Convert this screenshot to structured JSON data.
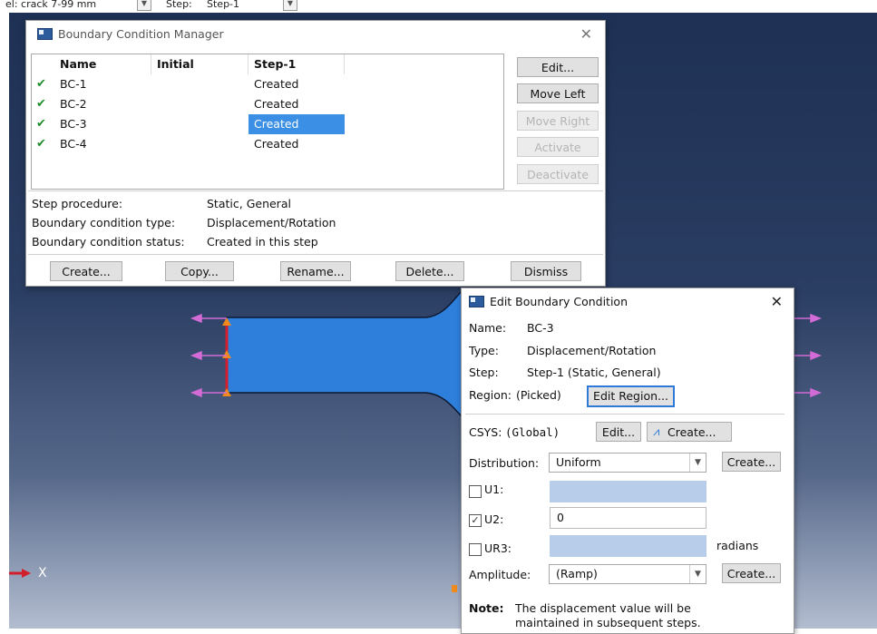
{
  "topbar": {
    "left_fragment": "el: crack 7-99 mm",
    "step_label": "Step:",
    "step_value": "Step-1"
  },
  "bc_manager": {
    "title": "Boundary Condition Manager",
    "columns": [
      "Name",
      "Initial",
      "Step-1"
    ],
    "rows": [
      {
        "name": "BC-1",
        "initial": "",
        "step1": "Created"
      },
      {
        "name": "BC-2",
        "initial": "",
        "step1": "Created"
      },
      {
        "name": "BC-3",
        "initial": "",
        "step1": "Created"
      },
      {
        "name": "BC-4",
        "initial": "",
        "step1": "Created"
      }
    ],
    "side_buttons": [
      "Edit...",
      "Move Left",
      "Move Right",
      "Activate",
      "Deactivate"
    ],
    "info": {
      "procedure_label": "Step procedure:",
      "procedure_value": "Static, General",
      "type_label": "Boundary condition type:",
      "type_value": "Displacement/Rotation",
      "status_label": "Boundary condition status:",
      "status_value": "Created in this step"
    },
    "bottom_buttons": [
      "Create...",
      "Copy...",
      "Rename...",
      "Delete...",
      "Dismiss"
    ]
  },
  "edit_bc": {
    "title": "Edit Boundary Condition",
    "name_label": "Name:",
    "name_value": "BC-3",
    "type_label": "Type:",
    "type_value": "Displacement/Rotation",
    "step_label": "Step:",
    "step_value": "Step-1 (Static, General)",
    "region_label": "Region:",
    "region_value": "(Picked)",
    "edit_region_button": "Edit Region...",
    "csys_label": "CSYS:",
    "csys_value": "(Global)",
    "csys_edit_button": "Edit...",
    "csys_create_button": "Create...",
    "distribution_label": "Distribution:",
    "distribution_value": "Uniform",
    "distribution_create_button": "Create...",
    "u1_label": "U1:",
    "u1_value": "",
    "u1_checked": false,
    "u2_label": "U2:",
    "u2_value": "0",
    "u2_checked": true,
    "ur3_label": "UR3:",
    "ur3_value": "",
    "ur3_checked": false,
    "ur3_unit": "radians",
    "amplitude_label": "Amplitude:",
    "amplitude_value": "(Ramp)",
    "amplitude_create_button": "Create...",
    "note_label": "Note:",
    "note_line1": "The displacement value will be",
    "note_line2": "maintained in subsequent steps."
  },
  "viewport": {
    "triad_label": "X"
  },
  "colors": {
    "selection": "#3b8fe4",
    "model_fill": "#2e7fdb",
    "checkmark": "#1e8e2a",
    "load_arrow": "#d36bd6",
    "bc_marker": "#f08a1c"
  }
}
